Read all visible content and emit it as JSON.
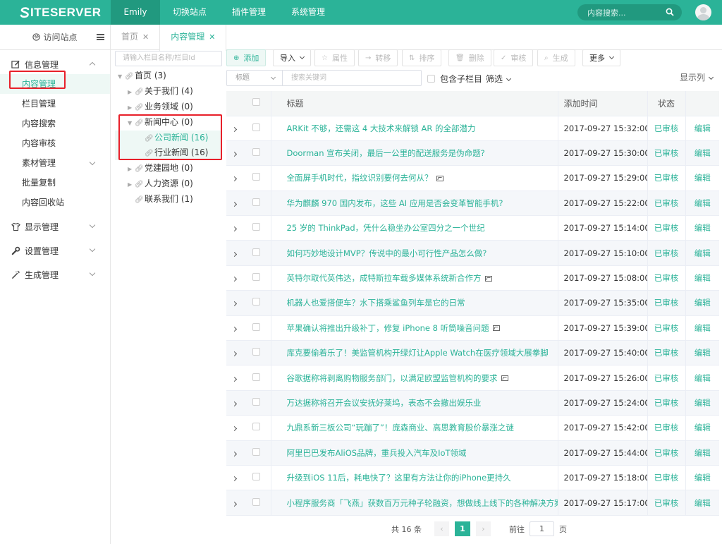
{
  "brand": {
    "name": "ITESERVER",
    "initial": "S"
  },
  "topnav": {
    "user": "Emily",
    "items": [
      "切换站点",
      "插件管理",
      "系统管理"
    ]
  },
  "search": {
    "placeholder": "内容搜索..."
  },
  "sidebar": {
    "visit": "访问站点",
    "groups": [
      {
        "label": "信息管理",
        "icon": "edit-icon",
        "items": [
          "内容管理",
          "栏目管理",
          "内容搜索",
          "内容审核",
          "素材管理",
          "批量复制",
          "内容回收站"
        ]
      },
      {
        "label": "显示管理",
        "icon": "shirt-icon"
      },
      {
        "label": "设置管理",
        "icon": "wrench-icon"
      },
      {
        "label": "生成管理",
        "icon": "magic-wand-icon"
      }
    ]
  },
  "tabs": [
    {
      "label": "首页"
    },
    {
      "label": "内容管理"
    }
  ],
  "tree": {
    "placeholder": "请输入栏目名称/栏目Id",
    "nodes": [
      {
        "label": "首页 (3)"
      },
      {
        "label": "关于我们 (4)"
      },
      {
        "label": "业务领域 (0)"
      },
      {
        "label": "新闻中心 (0)"
      },
      {
        "label": "公司新闻 (16)"
      },
      {
        "label": "行业新闻 (16)"
      },
      {
        "label": "党建园地 (0)"
      },
      {
        "label": "人力资源 (0)"
      },
      {
        "label": "联系我们 (1)"
      }
    ]
  },
  "toolbar": {
    "add": "添加",
    "import": "导入",
    "attr": "属性",
    "move": "转移",
    "sort": "排序",
    "delete": "删除",
    "review": "审核",
    "generate": "生成",
    "more": "更多"
  },
  "filter": {
    "field": "标题",
    "keyword_placeholder": "搜索关键词",
    "include_children": "包含子栏目",
    "filter": "筛选",
    "show_columns": "显示列"
  },
  "table": {
    "headers": {
      "title": "标题",
      "time": "添加时间",
      "status": "状态"
    },
    "rows": [
      {
        "title": "ARKit 不够，还需这 4 大技术来解锁 AR 的全部潜力",
        "time": "2017-09-27 15:32:00",
        "status": "已审核",
        "op": "编辑"
      },
      {
        "title": "Doorman 宣布关闭，最后一公里的配送服务是伪命题?",
        "time": "2017-09-27 15:30:00",
        "status": "已审核",
        "op": "编辑"
      },
      {
        "title": "全面屏手机时代，指纹识别要何去何从？",
        "time": "2017-09-27 15:29:00",
        "status": "已审核",
        "op": "编辑",
        "img": true
      },
      {
        "title": "华为麒麟 970 国内发布，这些 AI 应用是否会变革智能手机?",
        "time": "2017-09-27 15:22:00",
        "status": "已审核",
        "op": "编辑"
      },
      {
        "title": "25 岁的 ThinkPad，凭什么稳坐办公室四分之一个世纪",
        "time": "2017-09-27 15:14:00",
        "status": "已审核",
        "op": "编辑"
      },
      {
        "title": "如何巧妙地设计MVP？传说中的最小可行性产品怎么做?",
        "time": "2017-09-27 15:10:00",
        "status": "已审核",
        "op": "编辑"
      },
      {
        "title": "英特尔取代英伟达，成特斯拉车载多媒体系统新合作方",
        "time": "2017-09-27 15:08:00",
        "status": "已审核",
        "op": "编辑",
        "img": true
      },
      {
        "title": "机器人也爱搭便车？水下搭乘鲨鱼列车是它的日常",
        "time": "2017-09-27 15:35:00",
        "status": "已审核",
        "op": "编辑"
      },
      {
        "title": "苹果确认将推出升级补丁，修复 iPhone 8 听筒噪音问题",
        "time": "2017-09-27 15:39:00",
        "status": "已审核",
        "op": "编辑",
        "img": true
      },
      {
        "title": "库克要偷着乐了！美监管机构开绿灯让Apple Watch在医疗领域大展拳脚",
        "time": "2017-09-27 15:40:00",
        "status": "已审核",
        "op": "编辑"
      },
      {
        "title": "谷歌据称将剥离购物服务部门，以满足欧盟监管机构的要求",
        "time": "2017-09-27 15:26:00",
        "status": "已审核",
        "op": "编辑",
        "img": true
      },
      {
        "title": "万达据称将召开会议安抚好莱坞，表态不会撤出娱乐业",
        "time": "2017-09-27 15:24:00",
        "status": "已审核",
        "op": "编辑"
      },
      {
        "title": "九鼎系新三板公司“玩蹦了”！庞森商业、高思教育股价暴涨之谜",
        "time": "2017-09-27 15:42:00",
        "status": "已审核",
        "op": "编辑"
      },
      {
        "title": "阿里巴巴发布AliOS品牌，重兵投入汽车及IoT领域",
        "time": "2017-09-27 15:44:00",
        "status": "已审核",
        "op": "编辑"
      },
      {
        "title": "升级到iOS 11后，耗电快了？这里有方法让你的iPhone更持久",
        "time": "2017-09-27 15:18:00",
        "status": "已审核",
        "op": "编辑"
      },
      {
        "title": "小程序服务商「飞燕」获数百万元种子轮融资，想做线上线下的各种解决方案",
        "time": "2017-09-27 15:17:00",
        "status": "已审核",
        "op": "编辑"
      }
    ]
  },
  "pagination": {
    "total": "共 16 条",
    "current": "1",
    "goto_prefix": "前往",
    "goto_value": "1",
    "goto_suffix": "页"
  },
  "colors": {
    "accent": "#2bb398",
    "accent_dark": "#21997f",
    "highlight": "#e8202a"
  }
}
